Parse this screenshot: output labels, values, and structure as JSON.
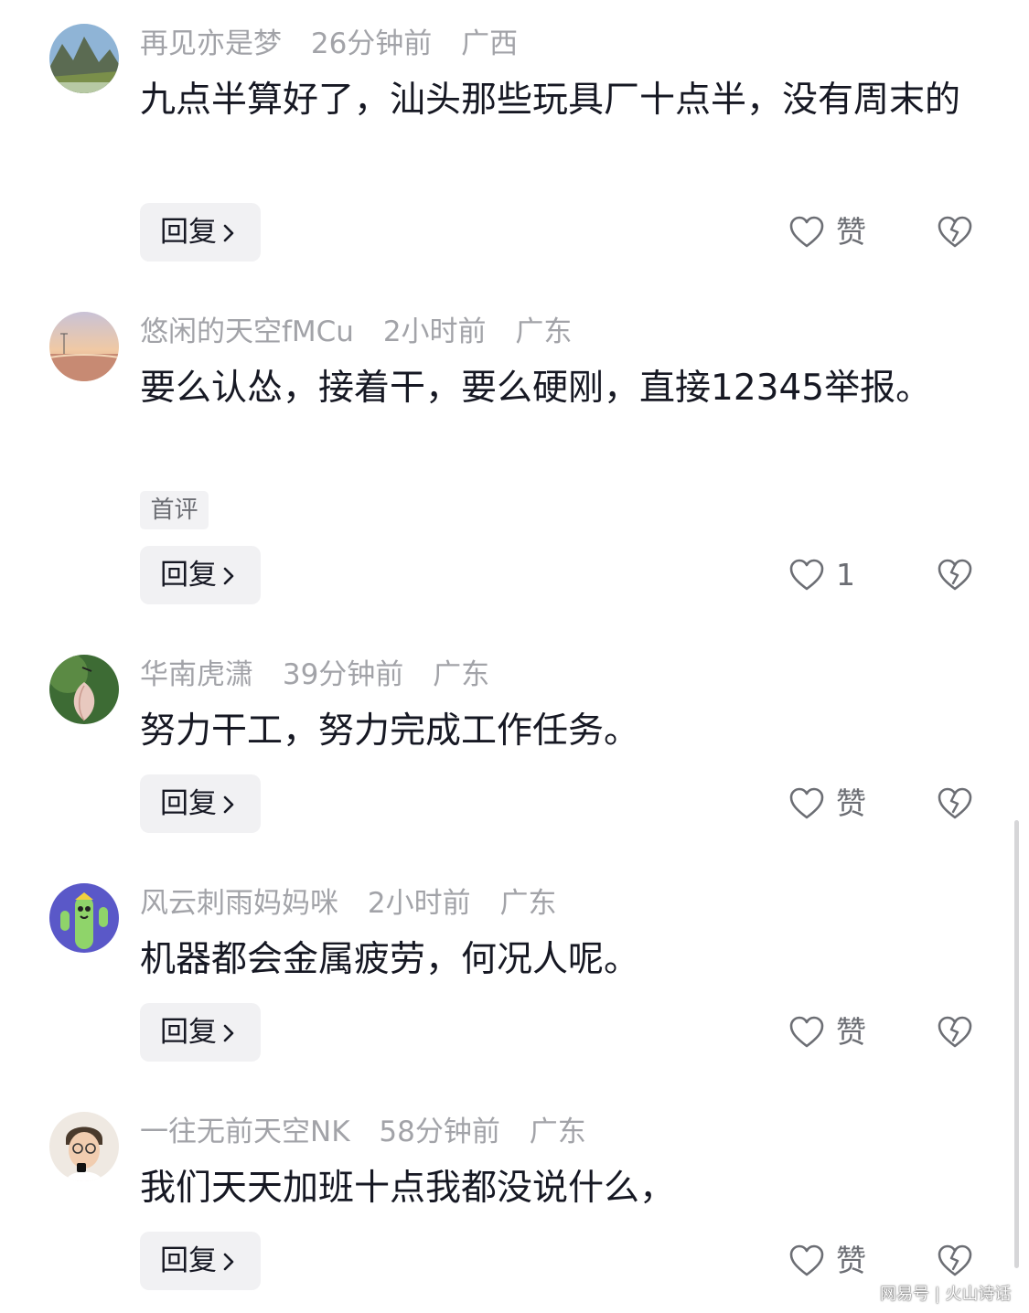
{
  "comments": [
    {
      "username": "再见亦是梦",
      "time": "26分钟前",
      "location": "广西",
      "text": "九点半算好了，汕头那些玩具厂十点半，没有周末的",
      "tag": "",
      "reply_label": "回复",
      "like_label": "赞"
    },
    {
      "username": "悠闲的天空fMCu",
      "time": "2小时前",
      "location": "广东",
      "text": "要么认怂，接着干，要么硬刚，直接12345举报。",
      "tag": "首评",
      "reply_label": "回复",
      "like_label": "1"
    },
    {
      "username": "华南虎潇",
      "time": "39分钟前",
      "location": "广东",
      "text": "努力干工，努力完成工作任务。",
      "tag": "",
      "reply_label": "回复",
      "like_label": "赞"
    },
    {
      "username": "风云刺雨妈妈咪",
      "time": "2小时前",
      "location": "广东",
      "text": "机器都会金属疲劳，何况人呢。",
      "tag": "",
      "reply_label": "回复",
      "like_label": "赞"
    },
    {
      "username": "一往无前天空NK",
      "time": "58分钟前",
      "location": "广东",
      "text": "我们天天加班十点我都没说什么，",
      "tag": "",
      "reply_label": "回复",
      "like_label": "赞"
    }
  ],
  "icons": {
    "like": "heart-outline-icon",
    "dislike": "broken-heart-icon",
    "reply_arrow": "chevron-right-icon"
  },
  "colors": {
    "text_primary": "#161823",
    "text_secondary": "#a2a3a8",
    "button_bg": "#f1f1f3"
  },
  "watermark": "网易号 | 火山诗话"
}
